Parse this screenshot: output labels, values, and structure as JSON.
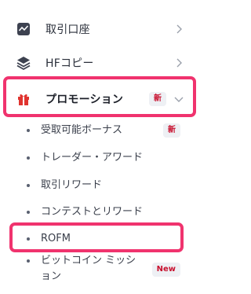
{
  "menu": {
    "items": [
      {
        "label": "取引口座",
        "icon": "chart-line-icon"
      },
      {
        "label": "HFコピー",
        "icon": "layers-icon"
      },
      {
        "label": "プロモーション",
        "icon": "gift-icon",
        "badge": "新"
      }
    ],
    "subitems": [
      {
        "label": "受取可能ボーナス",
        "badge": "新"
      },
      {
        "label": "トレーダー・アワード"
      },
      {
        "label": "取引リワード"
      },
      {
        "label": "コンテストとリワード"
      },
      {
        "label": "ROFM"
      },
      {
        "label_line1": "ビットコイン ミッシ",
        "label_line2": "ョン",
        "badge": "New"
      }
    ]
  },
  "colors": {
    "highlight": "#f0336e",
    "badge_text": "#c8102e",
    "gift": "#e0342f"
  }
}
